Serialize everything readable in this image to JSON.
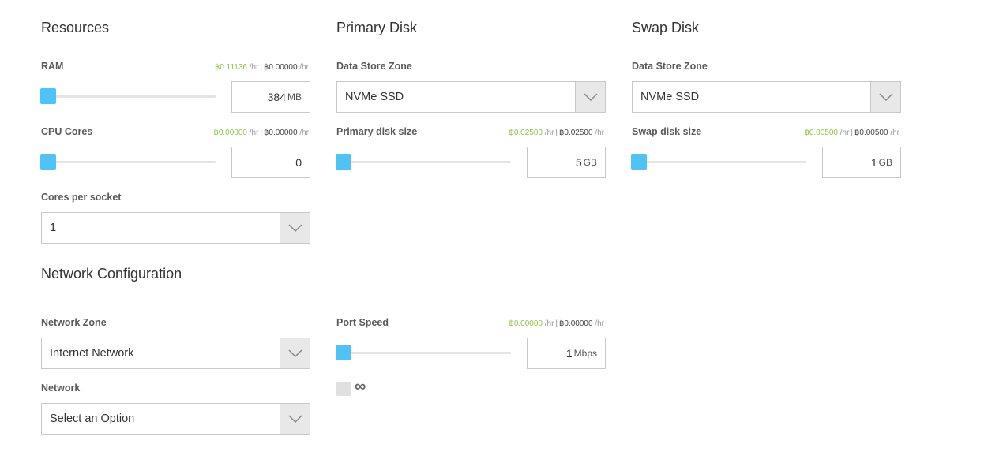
{
  "currency_symbol": "฿",
  "accent_color": "#4fc3f7",
  "price_color": "#8cc63f",
  "resources": {
    "title": "Resources",
    "ram": {
      "label": "RAM",
      "price_now": "฿0.11136",
      "price_max": "฿0.00000",
      "unit_hr": "/hr",
      "value": "384",
      "unit": "MB"
    },
    "cpu": {
      "label": "CPU Cores",
      "price_now": "฿0.00000",
      "price_max": "฿0.00000",
      "unit_hr": "/hr",
      "value": "0"
    },
    "cores_per_socket": {
      "label": "Cores per socket",
      "value": "1"
    }
  },
  "primary_disk": {
    "title": "Primary Disk",
    "zone": {
      "label": "Data Store Zone",
      "value": "NVMe SSD"
    },
    "size": {
      "label": "Primary disk size",
      "price_now": "฿0.02500",
      "price_max": "฿0.02500",
      "unit_hr": "/hr",
      "value": "5",
      "unit": "GB"
    }
  },
  "swap_disk": {
    "title": "Swap Disk",
    "zone": {
      "label": "Data Store Zone",
      "value": "NVMe SSD"
    },
    "size": {
      "label": "Swap disk size",
      "price_now": "฿0.00500",
      "price_max": "฿0.00500",
      "unit_hr": "/hr",
      "value": "1",
      "unit": "GB"
    }
  },
  "network": {
    "title": "Network Configuration",
    "zone": {
      "label": "Network Zone",
      "value": "Internet Network"
    },
    "network": {
      "label": "Network",
      "value": "Select an Option"
    },
    "port_speed": {
      "label": "Port Speed",
      "price_now": "฿0.00000",
      "price_max": "฿0.00000",
      "unit_hr": "/hr",
      "value": "1",
      "unit": "Mbps",
      "unlimited_symbol": "∞"
    }
  }
}
